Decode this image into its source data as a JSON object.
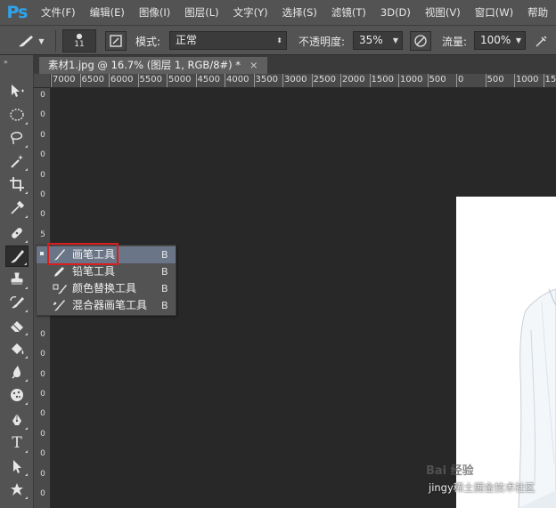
{
  "app": {
    "logo": "Ps"
  },
  "menu": [
    "文件(F)",
    "编辑(E)",
    "图像(I)",
    "图层(L)",
    "文字(Y)",
    "选择(S)",
    "滤镜(T)",
    "3D(D)",
    "视图(V)",
    "窗口(W)",
    "帮助"
  ],
  "options": {
    "brush_size": "11",
    "mode_label": "模式:",
    "mode_value": "正常",
    "opacity_label": "不透明度:",
    "opacity_value": "35%",
    "flow_label": "流量:",
    "flow_value": "100%"
  },
  "document": {
    "tab_title": "素材1.jpg @ 16.7% (图层 1, RGB/8#) *",
    "close": "×"
  },
  "ruler": {
    "horizontal": [
      "7000",
      "6500",
      "6000",
      "5500",
      "5000",
      "4500",
      "4000",
      "3500",
      "3000",
      "2500",
      "2000",
      "1500",
      "1000",
      "500",
      "0",
      "500",
      "1000",
      "1500"
    ],
    "vertical": [
      "0",
      "0",
      "0",
      "0",
      "0",
      "0",
      "0",
      "5",
      "0",
      "0",
      "0",
      "0",
      "0",
      "0",
      "0",
      "0",
      "0",
      "0",
      "0",
      "0",
      "0"
    ]
  },
  "flyout": {
    "items": [
      {
        "label": "画笔工具",
        "key": "B",
        "icon": "brush-icon",
        "selected": true
      },
      {
        "label": "铅笔工具",
        "key": "B",
        "icon": "pencil-icon",
        "selected": false
      },
      {
        "label": "颜色替换工具",
        "key": "B",
        "icon": "color-replacement-icon",
        "selected": false
      },
      {
        "label": "混合器画笔工具",
        "key": "B",
        "icon": "mixer-brush-icon",
        "selected": false
      }
    ]
  },
  "watermark": {
    "logo": "Bai 经验",
    "caption": "jingy稀土掘金技术社区"
  },
  "colors": {
    "panel": "#535353",
    "canvas": "#282828",
    "accent": "#2fa3ec",
    "highlight": "#d81e1e",
    "selection": "#6a7587"
  }
}
